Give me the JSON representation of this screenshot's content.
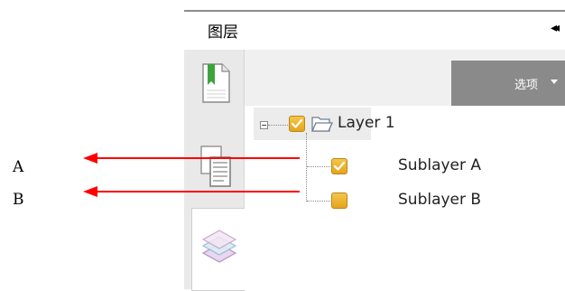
{
  "panel": {
    "title": "图层",
    "collapse_symbol": "◂◂",
    "options_label": "选项"
  },
  "sidebar": {
    "items": [
      {
        "name": "bookmarks",
        "icon": "bookmark-page-icon"
      },
      {
        "name": "pages",
        "icon": "pages-icon"
      },
      {
        "name": "layers",
        "icon": "layers-icon",
        "active": true
      }
    ]
  },
  "tree": {
    "root": {
      "label": "Layer 1",
      "checked": true
    },
    "children": [
      {
        "label": "Sublayer A",
        "checked": true
      },
      {
        "label": "Sublayer B",
        "checked": false
      }
    ]
  },
  "annotations": {
    "a": "A",
    "b": "B",
    "arrow_color": "#ff0000"
  },
  "colors": {
    "checkbox": "#f0b52c",
    "options_bg": "#8a8a8a",
    "sidebar_bg": "#e9e9e9"
  }
}
